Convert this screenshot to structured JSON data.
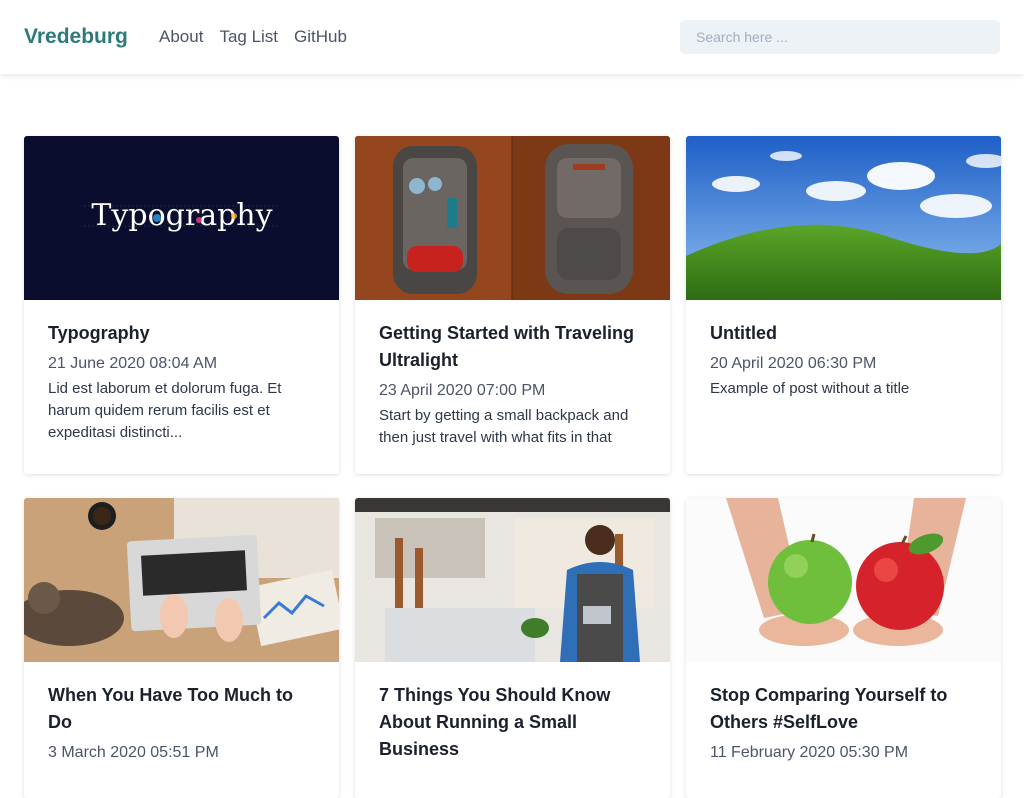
{
  "header": {
    "brand": "Vredeburg",
    "nav": [
      "About",
      "Tag List",
      "GitHub"
    ],
    "search_placeholder": "Search here ..."
  },
  "posts": [
    {
      "title": "Typography",
      "date": "21 June 2020 08:04 AM",
      "excerpt": "Lid est laborum et dolorum fuga. Et harum quidem rerum facilis est et expeditasi distincti...",
      "image": "typography"
    },
    {
      "title": "Getting Started with Traveling Ultralight",
      "date": "23 April 2020 07:00 PM",
      "excerpt": "Start by getting a small backpack and then just travel with what fits in that",
      "image": "backpacks"
    },
    {
      "title": "Untitled",
      "date": "20 April 2020 06:30 PM",
      "excerpt": "Example of post without a title",
      "image": "green-hill"
    },
    {
      "title": "When You Have Too Much to Do",
      "date": "3 March 2020 05:51 PM",
      "excerpt": "",
      "image": "laptop-desk-cat"
    },
    {
      "title": "7 Things You Should Know About Running a Small Business",
      "date": "",
      "excerpt": "",
      "image": "shop-owner"
    },
    {
      "title": "Stop Comparing Yourself to Others #SelfLove",
      "date": "11 February 2020 05:30 PM",
      "excerpt": "",
      "image": "apples"
    }
  ],
  "thumb_text": {
    "typography": "Typography"
  }
}
